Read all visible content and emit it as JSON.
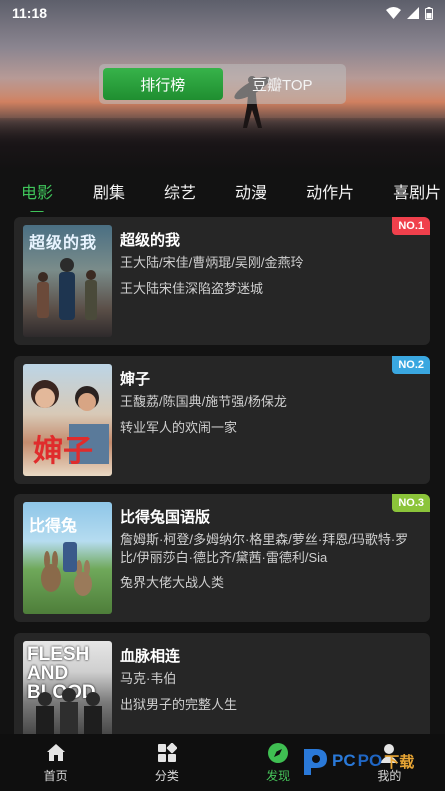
{
  "status": {
    "time": "11:18"
  },
  "switcher": {
    "active": "排行榜",
    "inactive": "豆瓣TOP"
  },
  "tabs": [
    "电影",
    "剧集",
    "综艺",
    "动漫",
    "动作片",
    "喜剧片"
  ],
  "movies": [
    {
      "title": "超级的我",
      "cast": "王大陆/宋佳/曹炳琨/吴刚/金燕玲",
      "desc": "王大陆宋佳深陷盗梦迷城",
      "rank": "NO.1",
      "rank_color": "#f0404c",
      "poster_text": "超级的我"
    },
    {
      "title": "婶子",
      "cast": "王馥荔/陈国典/施节强/杨保龙",
      "desc": "转业军人的欢闹一家",
      "rank": "NO.2",
      "rank_color": "#3aa7e0",
      "poster_text": "婶子"
    },
    {
      "title": "比得兔国语版",
      "cast": "詹姆斯·柯登/多姆纳尔·格里森/萝丝·拜恩/玛歌特·罗比/伊丽莎白·德比齐/黛茜·雷德利/Sia",
      "desc": "兔界大佬大战人类",
      "rank": "NO.3",
      "rank_color": "#8bc43a",
      "poster_text": "比得兔"
    },
    {
      "title": "血脉相连",
      "cast": "马克·韦伯",
      "desc": "出狱男子的完整人生",
      "rank": "",
      "rank_color": "",
      "poster_text": "FLESH AND BLOOD"
    }
  ],
  "nav": [
    {
      "label": "首页",
      "icon": "home-icon"
    },
    {
      "label": "分类",
      "icon": "category-icon"
    },
    {
      "label": "发现",
      "icon": "compass-icon"
    },
    {
      "label": "我的",
      "icon": "user-icon"
    }
  ],
  "watermark": {
    "p": "P",
    "text1": "PC",
    "text2": "PO",
    "text3": "下载"
  }
}
